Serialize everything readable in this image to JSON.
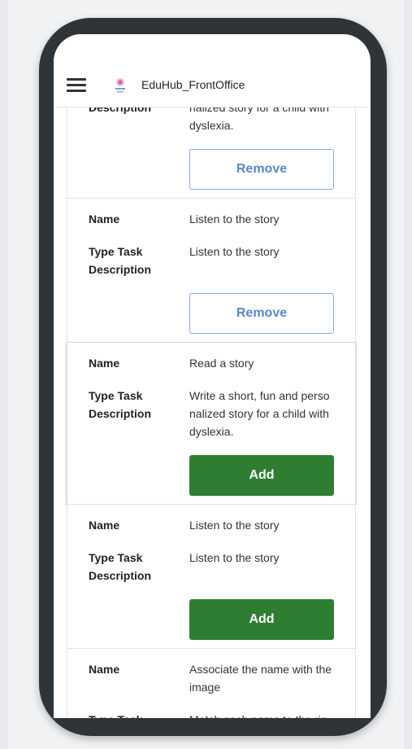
{
  "app": {
    "title": "EduHub_FrontOffice",
    "menu_icon": "hamburger-menu-icon",
    "logo_icon": "app-logo-icon"
  },
  "labels": {
    "name": "Name",
    "type_task": "Type Task",
    "description": "Description"
  },
  "buttons": {
    "remove": "Remove",
    "add": "Add"
  },
  "colors": {
    "add_green": "#2e7d32",
    "remove_text": "#5b86c8",
    "remove_border": "#8aa9cf",
    "phone_frame": "#2f3439"
  },
  "cards": [
    {
      "type_task": "Write a short, fun and personalized story for a child with dyslexia.",
      "action": "Remove"
    },
    {
      "name": "Listen to the story",
      "type_task": "Listen to the story",
      "action": "Remove"
    },
    {
      "name": "Read a story",
      "type_task": "Write a short, fun and personalized story for a child with dyslexia.",
      "action": "Add"
    },
    {
      "name": "Listen to the story",
      "type_task": "Listen to the story",
      "action": "Add"
    },
    {
      "name": "Associate the name with the image",
      "type_task": "Match each name to the rig"
    }
  ]
}
